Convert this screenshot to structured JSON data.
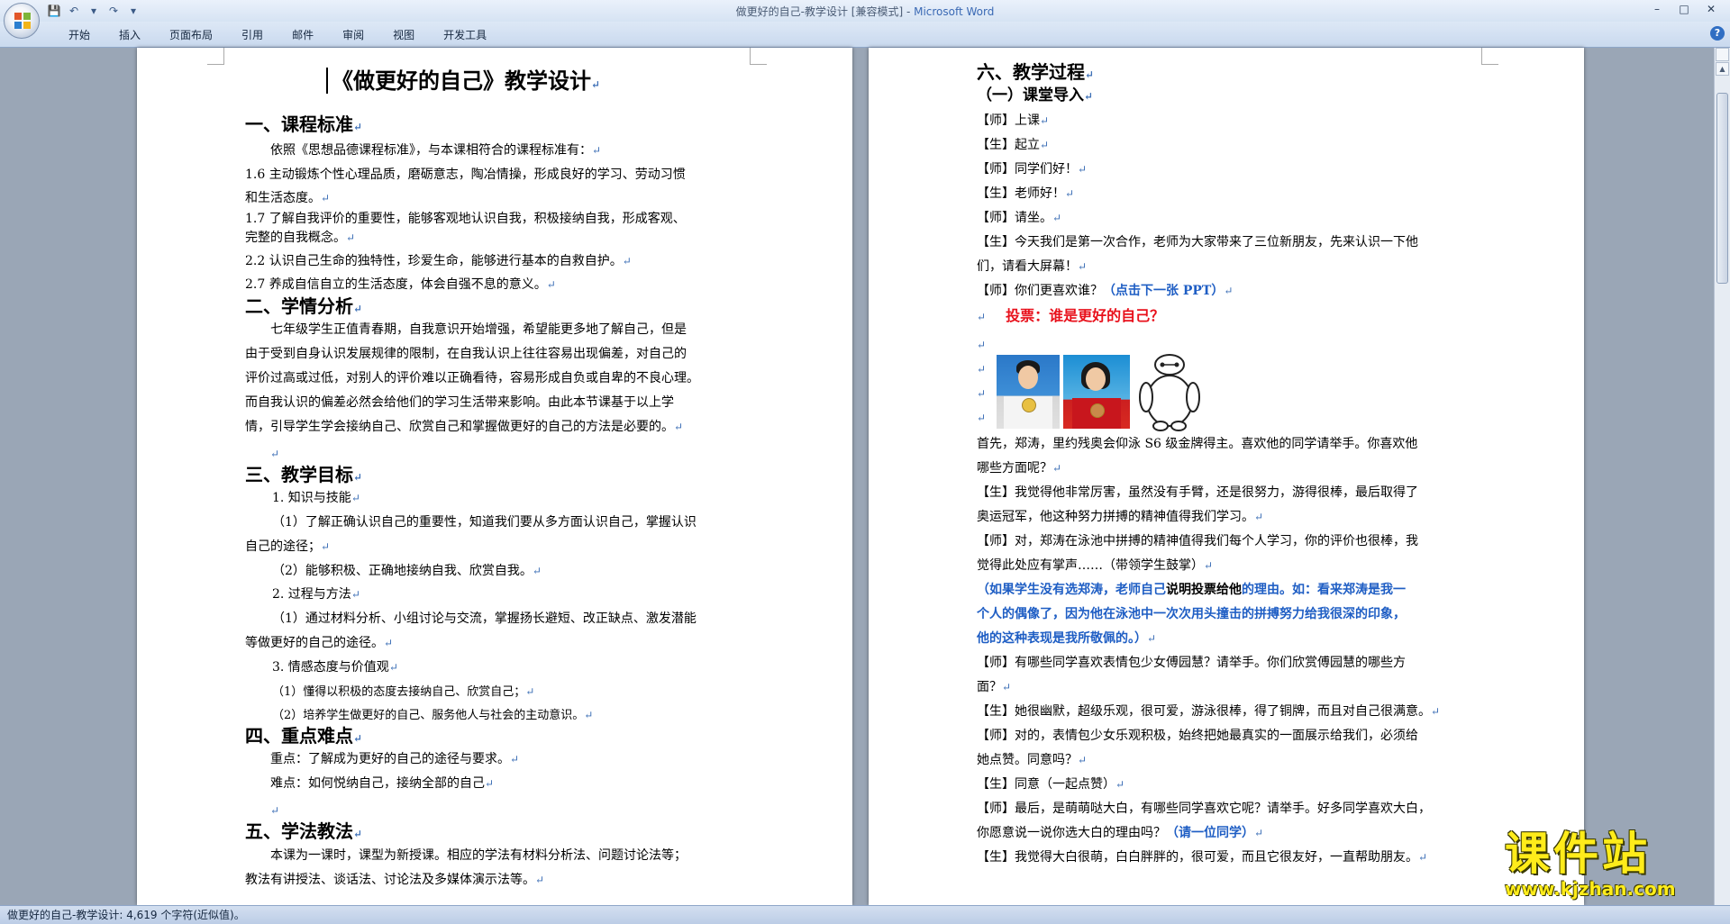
{
  "window": {
    "title": "做更好的自己-教学设计 [兼容模式] - ",
    "app_name": "Microsoft Word",
    "minimize": "–",
    "maximize": "□",
    "close": "✕"
  },
  "quick_access": {
    "save_icon": "💾",
    "undo_icon": "↶",
    "undo_dropdown": "▾",
    "redo_icon": "↷",
    "customize": "▾"
  },
  "ribbon": {
    "tabs": [
      "开始",
      "插入",
      "页面布局",
      "引用",
      "邮件",
      "审阅",
      "视图",
      "开发工具"
    ],
    "help": "?"
  },
  "left_page": {
    "title": "《做更好的自己》教学设计",
    "lines": [
      "一、课程标准",
      "依照《思想品德课程标准》，与本课相符合的课程标准有：",
      "1.6 主动锻炼个性心理品质，磨砺意志，陶冶情操，形成良好的学习、劳动习惯",
      "和生活态度。",
      "1.7 了解自我评价的重要性，能够客观地认识自我，积极接纳自我，形成客观、",
      "完整的自我概念。",
      "2.2 认识自己生命的独特性，珍爱生命，能够进行基本的自救自护。",
      "2.7 养成自信自立的生活态度，体会自强不息的意义。",
      "二、学情分析",
      "七年级学生正值青春期，自我意识开始增强，希望能更多地了解自己，但是",
      "由于受到自身认识发展规律的限制，在自我认识上往往容易出现偏差，对自己的",
      "评价过高或过低，对别人的评价难以正确看待，容易形成自负或自卑的不良心理。",
      "而自我认识的偏差必然会给他们的学习生活带来影响。由此本节课基于以上学",
      "情，引导学生学会接纳自己、欣赏自己和掌握做更好的自己的方法是必要的。",
      "三、教学目标",
      "1. 知识与技能",
      "（1）了解正确认识自己的重要性，知道我们要从多方面认识自己，掌握认识",
      "自己的途径；",
      "（2）能够积极、正确地接纳自我、欣赏自我。",
      "2. 过程与方法",
      "（1）通过材料分析、小组讨论与交流，掌握扬长避短、改正缺点、激发潜能",
      "等做更好的自己的途径。",
      "3. 情感态度与价值观",
      "（1）懂得以积极的态度去接纳自己、欣赏自己；",
      "（2）培养学生做更好的自己、服务他人与社会的主动意识。",
      "四、重点难点",
      "重点：了解成为更好的自己的途径与要求。",
      "难点：如何悦纳自己，接纳全部的自己",
      "五、学法教法",
      "本课为一课时，课型为新授课。相应的学法有材料分析法、问题讨论法等；",
      "教法有讲授法、谈话法、讨论法及多媒体演示法等。"
    ]
  },
  "right_page": {
    "h1": "六、教学过程",
    "h2": "（一）课堂导入",
    "d1": "【师】上课",
    "d2": "【生】起立",
    "d3": "【师】同学们好！",
    "d4": "【生】老师好！",
    "d5": "【师】请坐。",
    "d6a": "【生】今天我们是第一次合作，老师为大家带来了三位新朋友，先来认识一下他",
    "d6b": "们，请看大屏幕！",
    "d7": "【师】你们更喜欢谁？",
    "d7_blue": "（点击下一张 PPT）",
    "vote": "投票：谁是更好的自己？",
    "p1a": "首先，郑涛，里约残奥会仰泳 S6 级金牌得主。喜欢他的同学请举手。你喜欢他",
    "p1b": "哪些方面呢？",
    "p2a": "【生】我觉得他非常厉害，虽然没有手臂，还是很努力，游得很棒，最后取得了",
    "p2b": "奥运冠军，他这种努力拼搏的精神值得我们学习。",
    "p3a": "【师】对，郑涛在泳池中拼搏的精神值得我们每个人学习，你的评价也很棒，我",
    "p3b": "觉得此处应有掌声……（带领学生鼓掌）",
    "p4a_1": "（如果学生没有选郑涛，老师自己",
    "p4a_2": "说明投票给他",
    "p4a_3": "的理由。如：看来郑涛是我一",
    "p4b": "个人的偶像了，因为他在泳池中一次次用头撞击的拼搏努力给我很深的印象，",
    "p4c": "他的这种表现是我所敬佩的。）",
    "p5a": "【师】有哪些同学喜欢表情包少女傅园慧？请举手。你们欣赏傅园慧的哪些方",
    "p5b": "面？",
    "p6": "【生】她很幽默，超级乐观，很可爱，游泳很棒，得了铜牌，而且对自己很满意。",
    "p7a": "【师】对的，表情包少女乐观积极，始终把她最真实的一面展示给我们，必须给",
    "p7b": "她点赞。同意吗？",
    "p8": "【生】同意（一起点赞）",
    "p9a": "【师】最后，是萌萌哒大白，有哪些同学喜欢它呢？请举手。好多同学喜欢大白，",
    "p9b": "你愿意说一说你选大白的理由吗？",
    "p9b_blue": "（请一位同学）",
    "p10": "【生】我觉得大白很萌，白白胖胖的，很可爱，而且它很友好，一直帮助朋友。"
  },
  "paragraph_mark": "↵",
  "statusbar": {
    "text": "做更好的自己-教学设计: 4,619 个字符(近似值)。"
  },
  "watermark": {
    "cn": "课件站",
    "url": "www.kjzhan.com"
  },
  "colors": {
    "accent_blue": "#1f5ec4",
    "vote_red": "#e8101b",
    "watermark_yellow": "#ffec1a"
  }
}
